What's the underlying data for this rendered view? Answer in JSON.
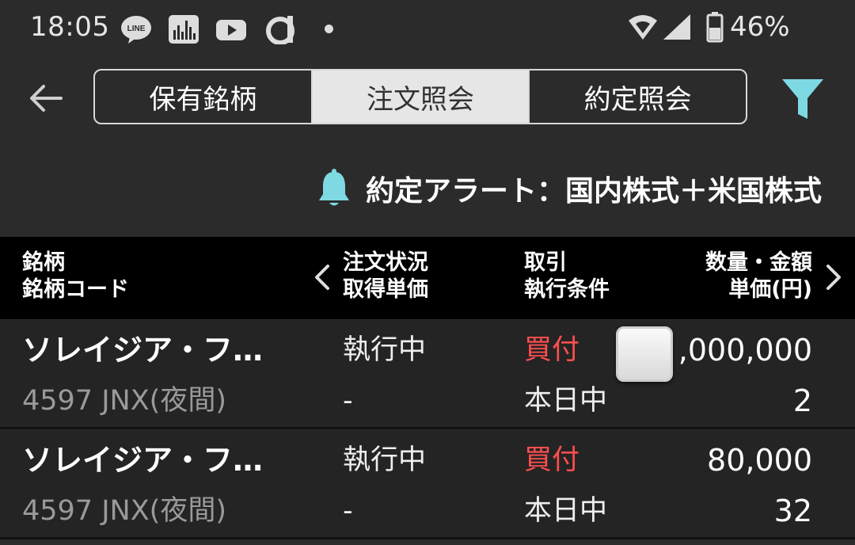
{
  "status_bar": {
    "time": "18:05",
    "battery": "46%",
    "icons": [
      "line-icon",
      "bars-app-icon",
      "youtube-icon",
      "d-app-icon",
      "notification-dot-icon",
      "wifi-icon",
      "signal-icon",
      "battery-icon"
    ]
  },
  "tabs": [
    {
      "label": "保有銘柄",
      "active": false
    },
    {
      "label": "注文照会",
      "active": true
    },
    {
      "label": "約定照会",
      "active": false
    }
  ],
  "alert": {
    "text": "約定アラート：国内株式＋米国株式"
  },
  "table": {
    "headers": [
      {
        "line1": "銘柄",
        "line2": "銘柄コード"
      },
      {
        "line1": "注文状況",
        "line2": "取得単価"
      },
      {
        "line1": "取引",
        "line2": "執行条件"
      },
      {
        "line1": "数量・金額",
        "line2": "単価(円)"
      }
    ],
    "rows": [
      {
        "name": "ソレイジア・フ…",
        "code": "4597  JNX(夜間)",
        "status": "執行中",
        "price": "-",
        "side": "買付",
        "condition": "本日中",
        "quantity": ",000,000",
        "unit_price": "2"
      },
      {
        "name": "ソレイジア・フ…",
        "code": "4597  JNX(夜間)",
        "status": "執行中",
        "price": "-",
        "side": "買付",
        "condition": "本日中",
        "quantity": "80,000",
        "unit_price": "32"
      }
    ]
  },
  "colors": {
    "accent": "#7fd9e3",
    "buy": "#ff4e4e",
    "background": "#2b2b2b",
    "header_bg": "#000000"
  }
}
